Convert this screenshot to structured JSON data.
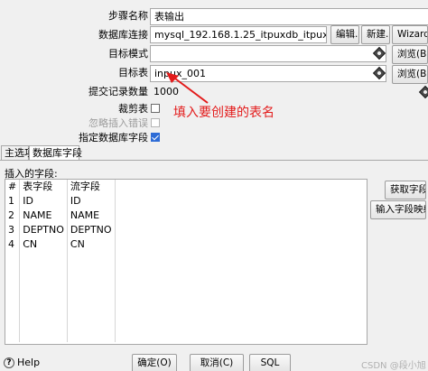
{
  "form": {
    "step_name_label": "步骤名称",
    "step_name_value": "表输出",
    "db_connection_label": "数据库连接",
    "db_connection_value": "mysql_192.168.1.25_itpuxdb_itpux",
    "edit_button": "编辑...",
    "new_button": "新建...",
    "wizard_button": "Wizard...",
    "target_schema_label": "目标模式",
    "target_schema_value": "",
    "browse_button": "浏览(B)...",
    "target_table_label": "目标表",
    "target_table_value": "inpux_001",
    "commit_size_label": "提交记录数量",
    "commit_size_value": "1000",
    "truncate_label": "裁剪表",
    "ignore_errors_label": "忽略插入错误",
    "specify_fields_label": "指定数据库字段"
  },
  "annotation": {
    "text": "填入要创建的表名"
  },
  "tabs": {
    "main": "主选项",
    "db_fields": "数据库字段"
  },
  "fields_panel": {
    "insert_fields_label": "插入的字段:",
    "get_fields_button": "获取字段",
    "input_field_mapping_button": "输入字段映射",
    "columns": [
      "#",
      "表字段",
      "流字段"
    ],
    "rows": [
      {
        "num": "1",
        "table_field": "ID",
        "stream_field": "ID"
      },
      {
        "num": "2",
        "table_field": "NAME",
        "stream_field": "NAME"
      },
      {
        "num": "3",
        "table_field": "DEPTNO",
        "stream_field": "DEPTNO"
      },
      {
        "num": "4",
        "table_field": "CN",
        "stream_field": "CN"
      }
    ]
  },
  "footer": {
    "help_button": "Help",
    "ok_button": "确定(O)",
    "cancel_button": "取消(C)",
    "sql_button": "SQL",
    "watermark": "CSDN @段小旭"
  },
  "icons": {
    "variable_icon": "diamond-variable-icon",
    "help_icon": "question-circle-icon"
  },
  "colors": {
    "annotation": "#e31b1b",
    "checkbox_checked": "#2d6bd6"
  }
}
